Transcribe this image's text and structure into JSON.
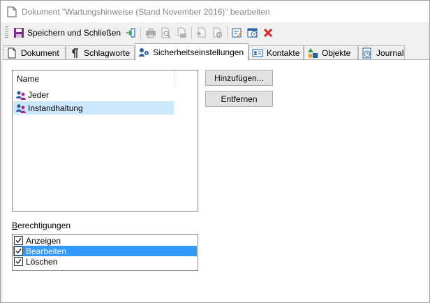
{
  "window": {
    "title": "Dokument \"Wartungshinweise (Stand November 2016)\" bearbeiten"
  },
  "toolbar": {
    "save_close_label": "Speichern und Schließen",
    "icons": [
      "save-icon",
      "exit-icon",
      "print-icon",
      "print-preview-icon",
      "print-setup-icon",
      "copy-document-icon",
      "move-document-icon",
      "edit-properties-icon",
      "schedule-icon",
      "delete-icon"
    ]
  },
  "tabs": [
    {
      "label": "Dokument",
      "icon": "document-icon"
    },
    {
      "label": "Schlagworte",
      "icon": "pilcrow-icon"
    },
    {
      "label": "Sicherheitseinstellungen",
      "icon": "security-icon",
      "active": true
    },
    {
      "label": "Kontakte",
      "icon": "contact-card-icon"
    },
    {
      "label": "Objekte",
      "icon": "objects-icon"
    },
    {
      "label": "Journal",
      "icon": "journal-icon"
    }
  ],
  "security": {
    "list_header": "Name",
    "groups": [
      {
        "name": "Jeder",
        "selected": false
      },
      {
        "name": "Instandhaltung",
        "selected": true
      }
    ],
    "add_button": "Hinzufügen...",
    "remove_button": "Entfernen",
    "permissions_label_accel": "B",
    "permissions_label_rest": "erechtigungen",
    "permissions": [
      {
        "label": "Anzeigen",
        "checked": true,
        "selected": false
      },
      {
        "label": "Bearbeiten",
        "checked": true,
        "selected": true
      },
      {
        "label": "Löschen",
        "checked": true,
        "selected": false
      }
    ]
  },
  "colors": {
    "selection": "#cce8ff",
    "selection_strong": "#3399ff",
    "delete_red": "#d9261c",
    "save_purple": "#7b2d8e"
  }
}
